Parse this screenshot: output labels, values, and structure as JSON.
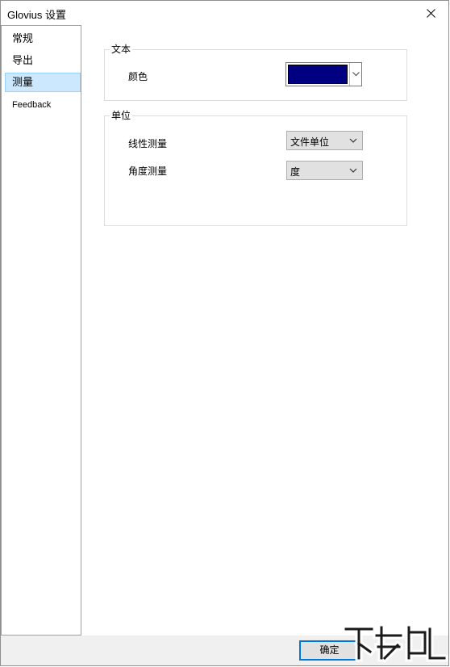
{
  "window": {
    "title": "Glovius 设置"
  },
  "sidebar": {
    "items": [
      {
        "label": "常规",
        "selected": false
      },
      {
        "label": "导出",
        "selected": false
      },
      {
        "label": "测量",
        "selected": true
      },
      {
        "label": "Feedback",
        "selected": false
      }
    ]
  },
  "text_group": {
    "legend": "文本",
    "color_label": "颜色",
    "color_value": "#000080"
  },
  "unit_group": {
    "legend": "单位",
    "linear_label": "线性测量",
    "linear_value": "文件单位",
    "angle_label": "角度测量",
    "angle_value": "度"
  },
  "footer": {
    "ok_label": "确定"
  },
  "icons": {
    "close": "close-icon",
    "dropdown": "chevron-down-icon",
    "watermark": "watermark-logo"
  }
}
